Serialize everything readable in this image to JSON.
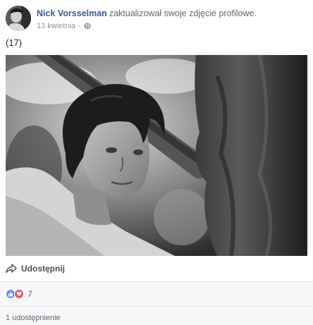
{
  "post": {
    "author": "Nick Vorsselman",
    "action": "zaktualizował swoje zdjęcie profilowe.",
    "timestamp": "13 kwietnia",
    "separator": "·",
    "privacy_icon": "globe-icon",
    "caption": "(17)",
    "photo_icon": "profile-photo"
  },
  "actions": {
    "share_label": "Udostępnij",
    "share_icon": "share-arrow-icon"
  },
  "reactions": {
    "types": [
      "like",
      "love"
    ],
    "count": "7"
  },
  "shares": {
    "label": "1 udostępnienie"
  },
  "colors": {
    "author": "#365899",
    "like": "#5890ff",
    "love": "#f25268",
    "footer_bg": "#f6f7f9"
  }
}
